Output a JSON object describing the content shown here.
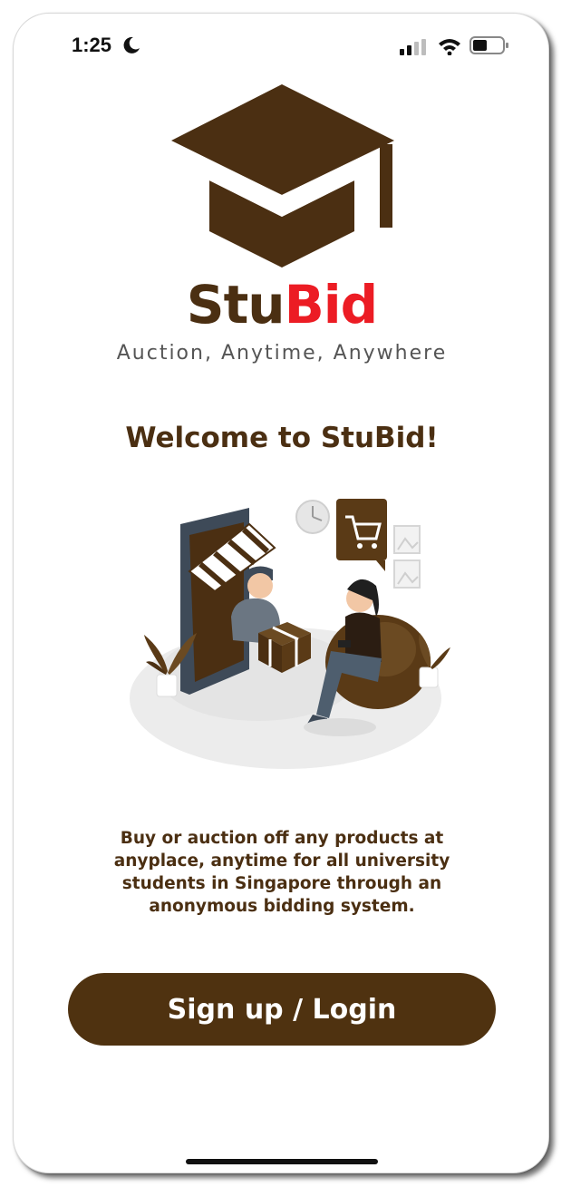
{
  "status_bar": {
    "time": "1:25"
  },
  "brand": {
    "name_part1": "Stu",
    "name_part2": "Bid",
    "tagline": "Auction, Anytime, Anywhere",
    "color_dark": "#4b2f12",
    "color_red": "#ec1c24"
  },
  "welcome": {
    "title": "Welcome to StuBid!"
  },
  "description": {
    "text": "Buy or auction off any products at anyplace, anytime for all university students in Singapore through an anonymous bidding system."
  },
  "cta": {
    "label": "Sign up / Login"
  },
  "icons": [
    "moon-icon",
    "cellular-signal-icon",
    "wifi-icon",
    "battery-icon",
    "graduation-cap-logo"
  ]
}
